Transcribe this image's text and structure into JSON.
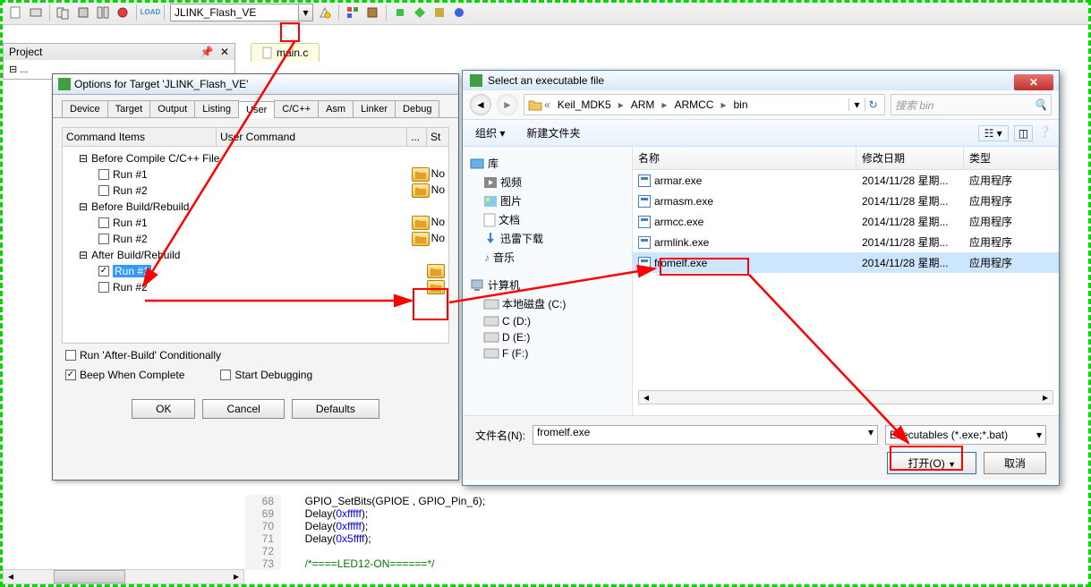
{
  "toolbar": {
    "target_combo": "JLINK_Flash_VE",
    "load_label": "LOAD"
  },
  "project_panel": {
    "title": "Project",
    "pin_icon": "pin-icon",
    "close_icon": "close-icon"
  },
  "editor": {
    "active_tab": "main.c",
    "code_lines": [
      {
        "n": 68,
        "t": "GPIO_SetBits(GPIOE , GPIO_Pin_6);"
      },
      {
        "n": 69,
        "t": "Delay(0xfffff);"
      },
      {
        "n": 70,
        "t": "Delay(0xfffff);"
      },
      {
        "n": 71,
        "t": "Delay(0x5ffff);"
      },
      {
        "n": 72,
        "t": ""
      },
      {
        "n": 73,
        "t": "/*====LED12-ON======*/"
      }
    ]
  },
  "options_dialog": {
    "title": "Options for Target 'JLINK_Flash_VE'",
    "tabs": [
      "Device",
      "Target",
      "Output",
      "Listing",
      "User",
      "C/C++",
      "Asm",
      "Linker",
      "Debug"
    ],
    "active_tab": "User",
    "grid_headers": [
      "Command Items",
      "User Command",
      "...",
      "St"
    ],
    "tree": {
      "before_compile": "Before Compile C/C++ File",
      "before_build": "Before Build/Rebuild",
      "after_build": "After Build/Rebuild",
      "run1": "Run #1",
      "run2": "Run #2"
    },
    "status_none": "No",
    "bottom": {
      "after_cond": "Run 'After-Build' Conditionally",
      "beep": "Beep When Complete",
      "start_dbg": "Start Debugging"
    },
    "buttons": {
      "ok": "OK",
      "cancel": "Cancel",
      "defaults": "Defaults"
    }
  },
  "file_dialog": {
    "title": "Select an executable file",
    "breadcrumb": [
      "Keil_MDK5",
      "ARM",
      "ARMCC",
      "bin"
    ],
    "search_placeholder": "搜索 bin",
    "toolbar": {
      "org": "组织 ▾",
      "newf": "新建文件夹"
    },
    "side_groups": {
      "libs": "库",
      "video": "视频",
      "pics": "图片",
      "docs": "文档",
      "xunlei": "迅雷下载",
      "music": "音乐",
      "computer": "计算机",
      "local_c": "本地磁盘 (C:)",
      "d": "C (D:)",
      "e": "D (E:)",
      "f": "F (F:)"
    },
    "list_headers": {
      "name": "名称",
      "date": "修改日期",
      "type": "类型"
    },
    "files": [
      {
        "name": "armar.exe",
        "date": "2014/11/28 星期...",
        "type": "应用程序"
      },
      {
        "name": "armasm.exe",
        "date": "2014/11/28 星期...",
        "type": "应用程序"
      },
      {
        "name": "armcc.exe",
        "date": "2014/11/28 星期...",
        "type": "应用程序"
      },
      {
        "name": "armlink.exe",
        "date": "2014/11/28 星期...",
        "type": "应用程序"
      },
      {
        "name": "fromelf.exe",
        "date": "2014/11/28 星期...",
        "type": "应用程序",
        "selected": true
      }
    ],
    "filename_label": "文件名(N):",
    "filename_value": "fromelf.exe",
    "filter": "Executables (*.exe;*.bat)",
    "open_btn": "打开(O)",
    "cancel_btn": "取消"
  }
}
